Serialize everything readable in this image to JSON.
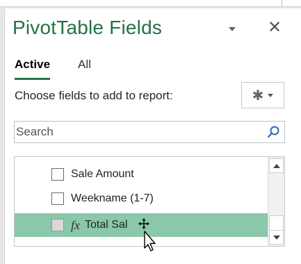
{
  "pane": {
    "title": "PivotTable Fields",
    "title_color": "#217346",
    "close_icon": "close-icon",
    "dropdown_icon": "chevron-down-icon"
  },
  "tabs": [
    {
      "label": "Active",
      "active": true
    },
    {
      "label": "All",
      "active": false
    }
  ],
  "choose_label": "Choose fields to add to report:",
  "tools_button": {
    "icon": "gear-icon",
    "dropdown_icon": "chevron-down-icon"
  },
  "search": {
    "placeholder": "Search",
    "value": "",
    "icon": "search-icon"
  },
  "fields": [
    {
      "label": "Sale Amount",
      "checked": false,
      "selected": false,
      "calculated": false
    },
    {
      "label": "Weekname (1-7)",
      "checked": false,
      "selected": false,
      "calculated": false
    },
    {
      "label": "Total Sal",
      "checked": false,
      "selected": true,
      "calculated": true,
      "fx_symbol": "fx"
    }
  ],
  "selection_color": "#8bc7a9"
}
